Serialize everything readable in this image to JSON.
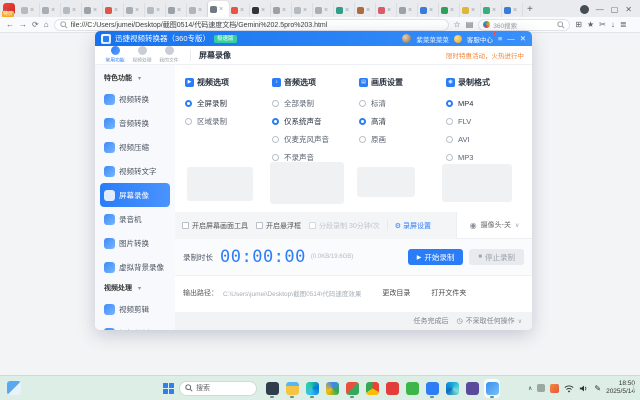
{
  "browser": {
    "logo_badge": "特价",
    "tabs": [
      {
        "c": "#b4bac1"
      },
      {
        "c": "#a8aeb5"
      },
      {
        "c": "#b4bac1"
      },
      {
        "c": "#9aa1a9"
      },
      {
        "c": "#e05545"
      },
      {
        "c": "#a8aeb5"
      },
      {
        "c": "#b4bac1"
      },
      {
        "c": "#9aa1a9"
      },
      {
        "c": "#aeb4bb"
      },
      {
        "c": "#707a84",
        "cls": "active"
      },
      {
        "c": "#e8543f"
      },
      {
        "c": "#30343a"
      },
      {
        "c": "#9aa1a9"
      },
      {
        "c": "#b4bac1"
      },
      {
        "c": "#a8aeb5"
      },
      {
        "c": "#2f9d8a"
      },
      {
        "c": "#b06a3a"
      },
      {
        "c": "#d95a6a"
      },
      {
        "c": "#9aa1a9"
      },
      {
        "c": "#3a7bd5"
      },
      {
        "c": "#2fa05a"
      },
      {
        "c": "#e0b63a"
      },
      {
        "c": "#35b07a"
      },
      {
        "c": "#3a7bd5"
      }
    ],
    "new_tab_label": "+",
    "url": "file:///C:/Users/jumei/Desktop/截图0514/代码速度文档/Gemini%202.5pro%203.html",
    "search_engine": "360搜索"
  },
  "app": {
    "window_title": "迅捷视频转换器（360专版）",
    "title_badge": "极速版",
    "user_name": "紫菜菜菜菜",
    "support_label": "客服中心",
    "nav": [
      {
        "label": "常用功能",
        "cls": "active"
      },
      {
        "label": "视频处理"
      },
      {
        "label": "我的文件"
      }
    ],
    "page_title": "屏幕录像",
    "promo_text": "限时特惠活动，火热进行中",
    "sidebar": [
      {
        "label": "特色功能",
        "cls": "header"
      },
      {
        "label": "视频转换"
      },
      {
        "label": "音频转换"
      },
      {
        "label": "视频压缩"
      },
      {
        "label": "视频转文字"
      },
      {
        "label": "屏幕录像",
        "cls": "active"
      },
      {
        "label": "录音机"
      },
      {
        "label": "图片转换"
      },
      {
        "label": "虚拟背景录像"
      },
      {
        "label": "视频处理",
        "cls": "header"
      },
      {
        "label": "视频剪辑"
      },
      {
        "label": "视频分割"
      }
    ],
    "option_groups": {
      "video": {
        "title": "视频选项",
        "items": [
          {
            "label": "全屏录制",
            "cls": "selected"
          },
          {
            "label": "区域录制"
          }
        ]
      },
      "audio": {
        "title": "音频选项",
        "items": [
          {
            "label": "全部录制"
          },
          {
            "label": "仅系统声音",
            "cls": "selected"
          },
          {
            "label": "仅麦克风声音"
          },
          {
            "label": "不录声音"
          }
        ]
      },
      "quality": {
        "title": "画质设置",
        "items": [
          {
            "label": "标清"
          },
          {
            "label": "高清",
            "cls": "selected"
          },
          {
            "label": "原画"
          }
        ]
      },
      "format": {
        "title": "录制格式",
        "items": [
          {
            "label": "MP4",
            "cls": "selected"
          },
          {
            "label": "FLV"
          },
          {
            "label": "AVI"
          },
          {
            "label": "MP3"
          }
        ]
      }
    },
    "toggles": [
      {
        "label": "开启屏幕画面工具"
      },
      {
        "label": "开启悬浮框"
      },
      {
        "label": "分段录制 30分钟/次",
        "cls": "disabled"
      }
    ],
    "settings_link": "录屏设置",
    "camera_select": "摄像头-关",
    "record": {
      "duration_label": "录制时长",
      "time": "00:00:00",
      "size_hint": "(0.0KB/19.6GB)",
      "start_label": "开始录制",
      "stop_label": "停止录制"
    },
    "output": {
      "label": "输出路径：",
      "path": "C:\\Users\\jumei\\Desktop\\截图0514\\代码速度效果",
      "change_label": "更改目录",
      "open_label": "打开文件夹"
    },
    "after_task": {
      "label": "任务完成后",
      "value": "不采取任何操作"
    }
  },
  "taskbar": {
    "search_placeholder": "搜索",
    "apps": [
      {
        "name": "dark-monitor-app",
        "bg": "#2f3d4d",
        "cls": "run"
      },
      {
        "name": "file-explorer",
        "bg": "linear-gradient(180deg,#58b7f0 30%,#f6c344 30%)",
        "cls": "run"
      },
      {
        "name": "edge-browser",
        "bg": "conic-gradient(from 200deg,#35c1f1,#2dcc9f,#0078d7,#35c1f1)",
        "cls": "run"
      },
      {
        "name": "drive-triangle-app",
        "bg": "conic-gradient(#4285f4,#34a853,#fbbc05,#4285f4)"
      },
      {
        "name": "colorful-grid-app",
        "bg": "linear-gradient(135deg,#e94f3d 50%,#35a85c 50%)",
        "cls": "run"
      },
      {
        "name": "chrome-browser",
        "bg": "conic-gradient(#ea4335 0 33%,#fbbc05 33% 66%,#34a853 66% 100%)"
      },
      {
        "name": "red-w-app",
        "bg": "#e23c3c"
      },
      {
        "name": "green-app",
        "bg": "#3cb54a"
      },
      {
        "name": "blue-square-app",
        "bg": "#2f7df6",
        "cls": "run"
      },
      {
        "name": "teal-swirl-app",
        "bg": "conic-gradient(#16a8e0,#7ce0d3,#0a6ebd,#16a8e0)"
      },
      {
        "name": "purple-app",
        "bg": "#5a4a9c"
      },
      {
        "name": "video-converter-app",
        "bg": "linear-gradient(135deg,#3b8df0,#77c3f7)",
        "cls": "active run"
      }
    ],
    "time": "18:50",
    "date": "2025/5/14"
  }
}
